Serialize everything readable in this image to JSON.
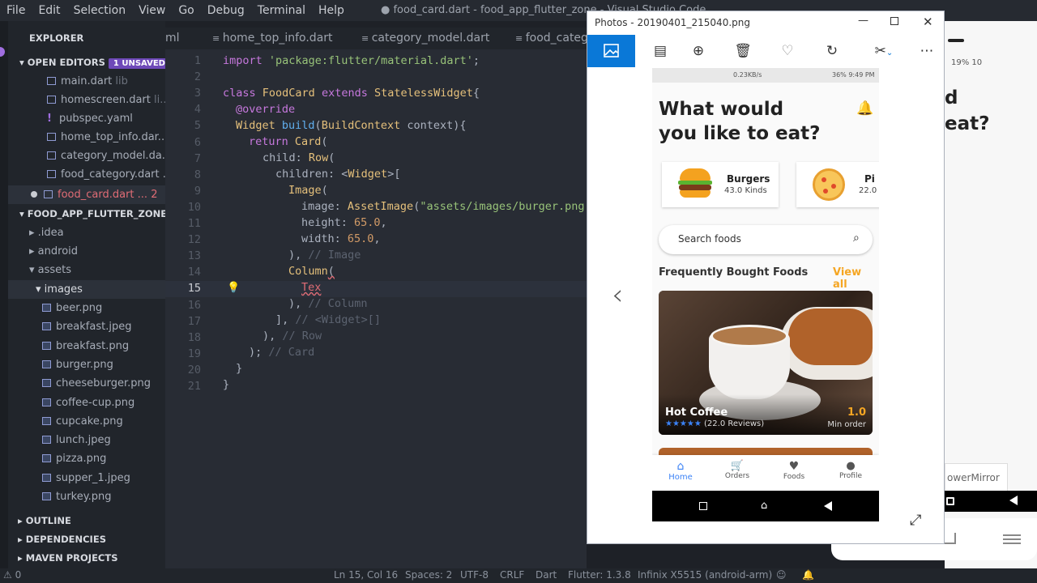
{
  "menu": [
    "File",
    "Edit",
    "Selection",
    "View",
    "Go",
    "Debug",
    "Terminal",
    "Help"
  ],
  "window_title": "● food_card.dart - food_app_flutter_zone - Visual Studio Code",
  "explorer": {
    "title": "EXPLORER",
    "open_editors": "OPEN EDITORS",
    "unsaved_badge": "1 UNSAVED",
    "open_files": [
      {
        "name": "main.dart",
        "hint": "lib"
      },
      {
        "name": "homescreen.dart",
        "hint": "li..."
      },
      {
        "name": "pubspec.yaml",
        "hint": ""
      },
      {
        "name": "home_top_info.dar...",
        "hint": ""
      },
      {
        "name": "category_model.da...",
        "hint": ""
      },
      {
        "name": "food_category.dart ...",
        "hint": ""
      }
    ],
    "active_file": {
      "name": "food_card.dart ...",
      "count": "2"
    },
    "project": "FOOD_APP_FLUTTER_ZONE",
    "folders": [
      ".idea",
      "android",
      "assets"
    ],
    "images_folder": "images",
    "images": [
      "beer.png",
      "breakfast.jpeg",
      "breakfast.png",
      "burger.png",
      "cheeseburger.png",
      "coffee-cup.png",
      "cupcake.png",
      "lunch.jpeg",
      "pizza.png",
      "supper_1.jpeg",
      "turkey.png"
    ],
    "bottom_sections": [
      "OUTLINE",
      "DEPENDENCIES",
      "MAVEN PROJECTS"
    ]
  },
  "tabs": [
    "ml",
    "home_top_info.dart",
    "category_model.dart",
    "food_categ"
  ],
  "line_numbers": [
    "1",
    "2",
    "3",
    "4",
    "5",
    "6",
    "7",
    "8",
    "9",
    "10",
    "11",
    "12",
    "13",
    "14",
    "15",
    "16",
    "17",
    "18",
    "19",
    "20",
    "21"
  ],
  "code": {
    "l1a": "import ",
    "l1b": "'package:flutter/material.dart'",
    "l1c": ";",
    "l3a": "class ",
    "l3b": "FoodCard ",
    "l3c": "extends ",
    "l3d": "StatelessWidget",
    "l3e": "{",
    "l4": "@override",
    "l5a": "Widget ",
    "l5b": "build",
    "l5c": "(",
    "l5d": "BuildContext ",
    "l5e": "context){",
    "l6a": "return ",
    "l6b": "Card",
    "l6c": "(",
    "l7a": "child: ",
    "l7b": "Row",
    "l7c": "(",
    "l8a": "children: <",
    "l8b": "Widget",
    "l8c": ">[",
    "l9a": "Image",
    "l9b": "(",
    "l10a": "image: ",
    "l10b": "AssetImage",
    "l10c": "(",
    "l10d": "\"assets/images/burger.png",
    "l11a": "height: ",
    "l11b": "65.0",
    "l12a": "width: ",
    "l12b": "65.0",
    "l13a": "), ",
    "l13b": "// Image",
    "l14a": "Column",
    "l14b": "(",
    "l15": "Tex",
    "l16a": "), ",
    "l16b": "// Column",
    "l17a": "], ",
    "l17b": "// <Widget>[]",
    "l18a": "), ",
    "l18b": "// Row",
    "l19a": "); ",
    "l19b": "// Card",
    "l20": "}",
    "l21": "}",
    "comma": ","
  },
  "status": {
    "problems": "0",
    "position": "Ln 15, Col 16",
    "spaces": "Spaces: 2",
    "encoding": "UTF-8",
    "eol": "CRLF",
    "language": "Dart",
    "flutter": "Flutter: 1.3.8",
    "device": "Infinix X5515 (android-arm)"
  },
  "photos": {
    "title": "Photos - 20190401_215040.png"
  },
  "phone": {
    "statusbar_left": "0.23KB/s",
    "statusbar_right": "36% 9:49 PM",
    "heading1": "What would",
    "heading2": "you like to eat?",
    "categories": [
      {
        "name": "Burgers",
        "kinds": "43.0 Kinds"
      },
      {
        "name": "Pi",
        "kinds": "22.0"
      }
    ],
    "search_placeholder": "Search foods",
    "section_title": "Frequently Bought Foods",
    "view_all": "View all",
    "food": {
      "name": "Hot Coffee",
      "reviews": "(22.0 Reviews)",
      "price": "1.0",
      "min_order": "Min order"
    },
    "nav": [
      {
        "label": "Home",
        "icon": "home-icon"
      },
      {
        "label": "Orders",
        "icon": "cart-icon"
      },
      {
        "label": "Foods",
        "icon": "heart-icon"
      },
      {
        "label": "Profile",
        "icon": "person-icon"
      }
    ]
  },
  "background_app": {
    "heading1": "d",
    "heading2": "eat?",
    "phone_status": "19% 10",
    "mirror_label": "owerMirror"
  },
  "colors": {
    "accent": "#3b82f6",
    "orange": "#f5a623",
    "code_bg": "#282c34",
    "sidebar_bg": "#21252b"
  }
}
